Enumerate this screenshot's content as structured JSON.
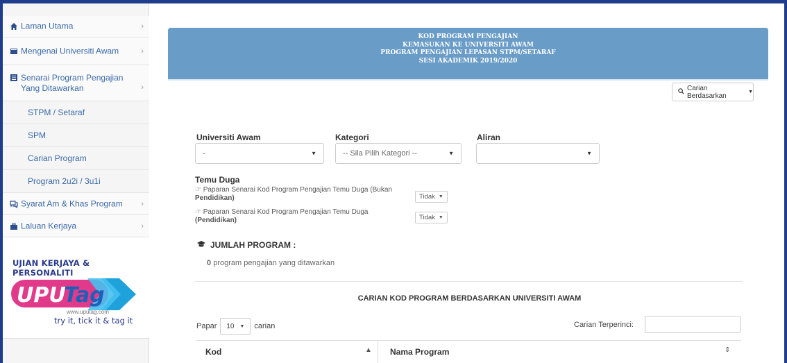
{
  "sidebar": {
    "items": [
      {
        "label": "Laman Utama",
        "icon": "home-icon"
      },
      {
        "label": "Mengenai Universiti Awam",
        "icon": "book-icon"
      },
      {
        "label_line1": "Senarai Program Pengajian",
        "label_line2": "Yang Ditawarkan",
        "icon": "list-icon"
      },
      {
        "label": "Syarat Am & Khas Program",
        "icon": "chat-icon"
      },
      {
        "label": "Laluan Kerjaya",
        "icon": "briefcase-icon"
      }
    ],
    "subitems": [
      "STPM / Setaraf",
      "SPM",
      "Carian Program",
      "Program 2u2i / 3u1i"
    ],
    "promo": {
      "title": "UJIAN KERJAYA & PERSONALITI",
      "logo": "UPUTag",
      "url": "www.uputag.com",
      "slogan": "try it, tick it & tag it"
    }
  },
  "banner": {
    "lines": [
      "KOD PROGRAM PENGAJIAN",
      "KEMASUKAN KE UNIVERSITI AWAM",
      "PROGRAM PENGAJIAN LEPASAN STPM/SETARAF",
      "SESI AKADEMIK 2019/2020"
    ]
  },
  "search_dropdown": {
    "label": "Carian Berdasarkan"
  },
  "filters": {
    "universiti_label": "Universiti Awam",
    "universiti_value": "-",
    "kategori_label": "Kategori",
    "kategori_value": "-- Sila Pilih Kategori --",
    "aliran_label": "Aliran",
    "aliran_value": ""
  },
  "temu_duga": {
    "label": "Temu Duga",
    "option1_line1": "Paparan Senarai Kod Program Pengajian Temu Duga (Bukan",
    "option1_line2": "Pendidikan)",
    "option2_line1": "Paparan Senarai Kod Program Pengajian Temu Duga",
    "option2_line2": "(Pendidikan)",
    "option1_value": "Tidak",
    "option2_value": "Tidak"
  },
  "summary": {
    "label": "JUMLAH PROGRAM :",
    "count": "0",
    "text": "program pengajian yang ditawarkan"
  },
  "table": {
    "title": "CARIAN KOD PROGRAM BERDASARKAN UNIVERSITI AWAM",
    "show_label": "Papar",
    "show_value": "10",
    "show_suffix": "carian",
    "search_label": "Carian Terperinci:",
    "columns": [
      "Kod",
      "Nama Program"
    ]
  },
  "colors": {
    "banner": "#6a9cc8",
    "link": "#3b6aa8",
    "frame": "#1f3d8c"
  }
}
